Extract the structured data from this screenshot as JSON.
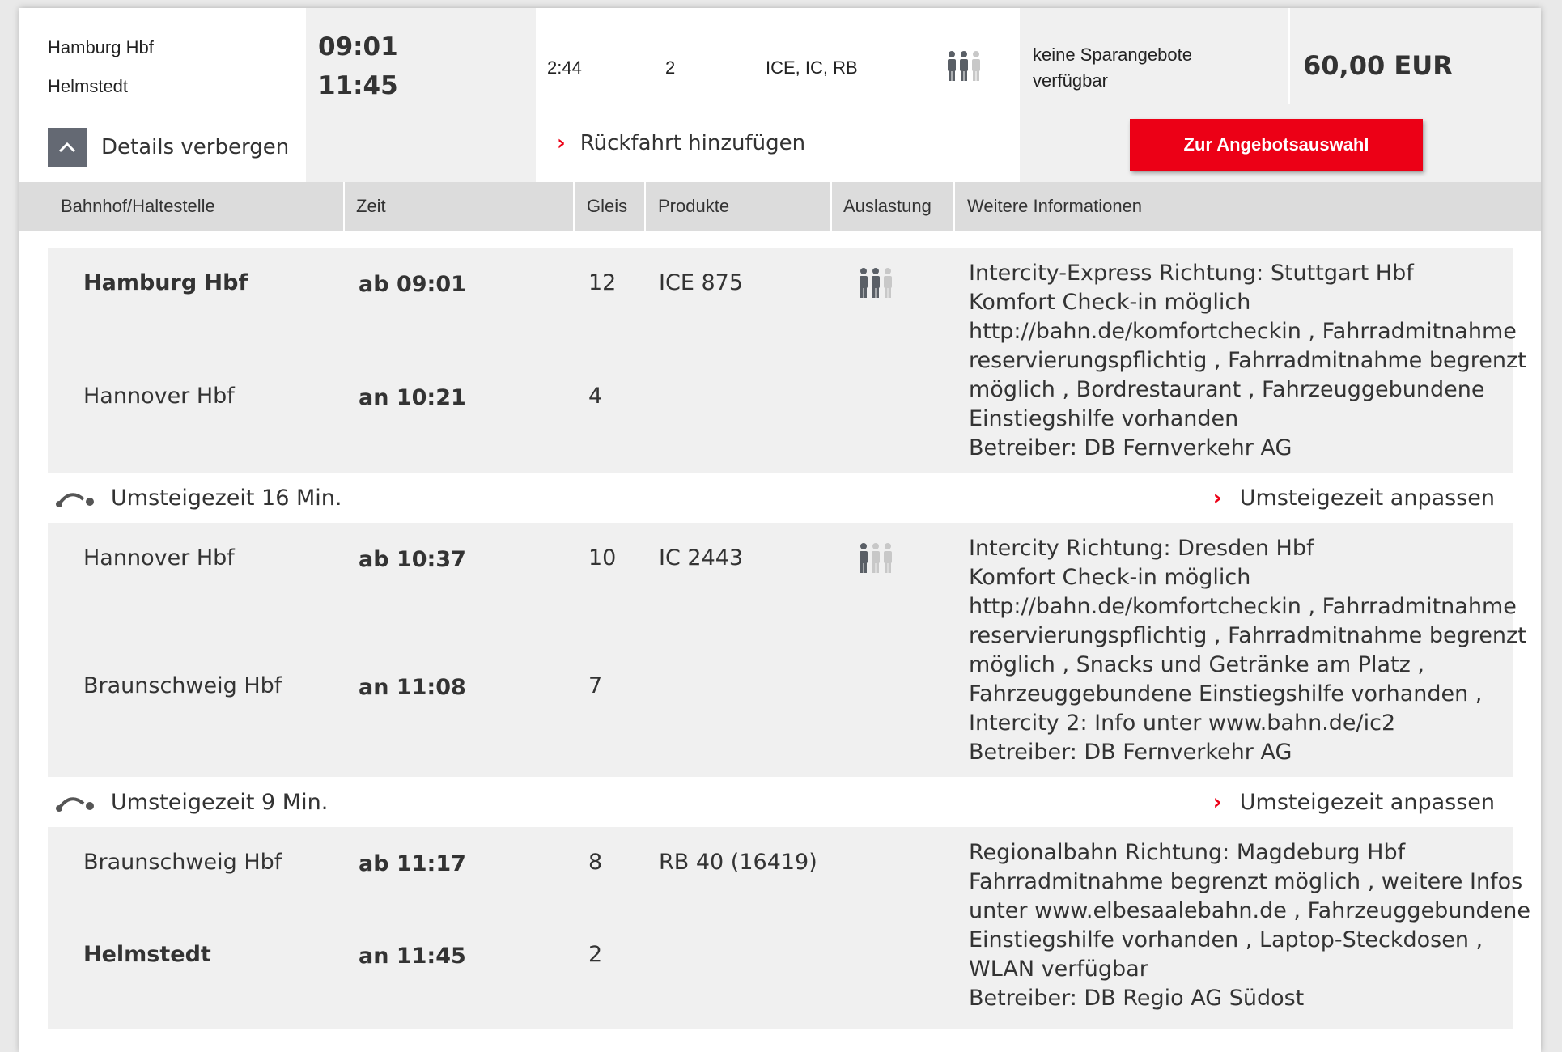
{
  "summary": {
    "from_station": "Hamburg Hbf",
    "to_station": "Helmstedt",
    "departure": "09:01",
    "arrival": "11:45",
    "duration": "2:44",
    "changes": "2",
    "products": "ICE, IC, RB",
    "offer_text": "keine Sparangebote verfügbar",
    "price": "60,00 EUR",
    "details_toggle_label": "Details verbergen",
    "return_link": "Rückfahrt hinzufügen",
    "cta_label": "Zur Angebotsauswahl",
    "occupancy_level": 2
  },
  "columns": [
    "Bahnhof/Haltestelle",
    "Zeit",
    "Gleis",
    "Produkte",
    "Auslastung",
    "Weitere Informationen"
  ],
  "segments": [
    {
      "dep_station": "Hamburg Hbf",
      "dep_time": "ab 09:01",
      "dep_track": "12",
      "arr_station": "Hannover Hbf",
      "arr_time": "an 10:21",
      "arr_track": "4",
      "product": "ICE 875",
      "occupancy_level": 2,
      "info": [
        "Intercity-Express Richtung: Stuttgart Hbf",
        "Komfort Check-in möglich",
        "http://bahn.de/komfortcheckin , Fahrradmitnahme",
        "reservierungspflichtig , Fahrradmitnahme begrenzt",
        "möglich , Bordrestaurant , Fahrzeuggebundene",
        "Einstiegshilfe vorhanden",
        "Betreiber: DB Fernverkehr AG"
      ]
    },
    {
      "dep_station": "Hannover Hbf",
      "dep_time": "ab 10:37",
      "dep_track": "10",
      "arr_station": "Braunschweig Hbf",
      "arr_time": "an 11:08",
      "arr_track": "7",
      "product": "IC 2443",
      "occupancy_level": 1,
      "info": [
        "Intercity Richtung: Dresden Hbf",
        "Komfort Check-in möglich",
        "http://bahn.de/komfortcheckin , Fahrradmitnahme",
        "reservierungspflichtig , Fahrradmitnahme begrenzt",
        "möglich , Snacks und Getränke am Platz ,",
        "Fahrzeuggebundene Einstiegshilfe vorhanden ,",
        "Intercity 2: Info unter www.bahn.de/ic2",
        "Betreiber: DB Fernverkehr AG"
      ]
    },
    {
      "dep_station": "Braunschweig Hbf",
      "dep_time": "ab 11:17",
      "dep_track": "8",
      "arr_station": "Helmstedt",
      "arr_time": "an 11:45",
      "arr_track": "2",
      "product": "RB 40 (16419)",
      "occupancy_level": null,
      "info": [
        "Regionalbahn Richtung: Magdeburg Hbf",
        "Fahrradmitnahme begrenzt möglich , weitere Infos",
        "unter www.elbesaalebahn.de , Fahrzeuggebundene",
        "Einstiegshilfe vorhanden , Laptop-Steckdosen ,",
        "WLAN verfügbar",
        "Betreiber: DB Regio AG Südost"
      ]
    }
  ],
  "transfers": [
    {
      "label": "Umsteigezeit 16 Min.",
      "action": "Umsteigezeit anpassen"
    },
    {
      "label": "Umsteigezeit 9 Min.",
      "action": "Umsteigezeit anpassen"
    }
  ],
  "colors": {
    "accent": "#ec0016",
    "panel": "#f0f0f0",
    "header": "#dcdcdc",
    "occupancy_filled": "#5a5f66",
    "occupancy_empty": "#c8c8c8"
  }
}
